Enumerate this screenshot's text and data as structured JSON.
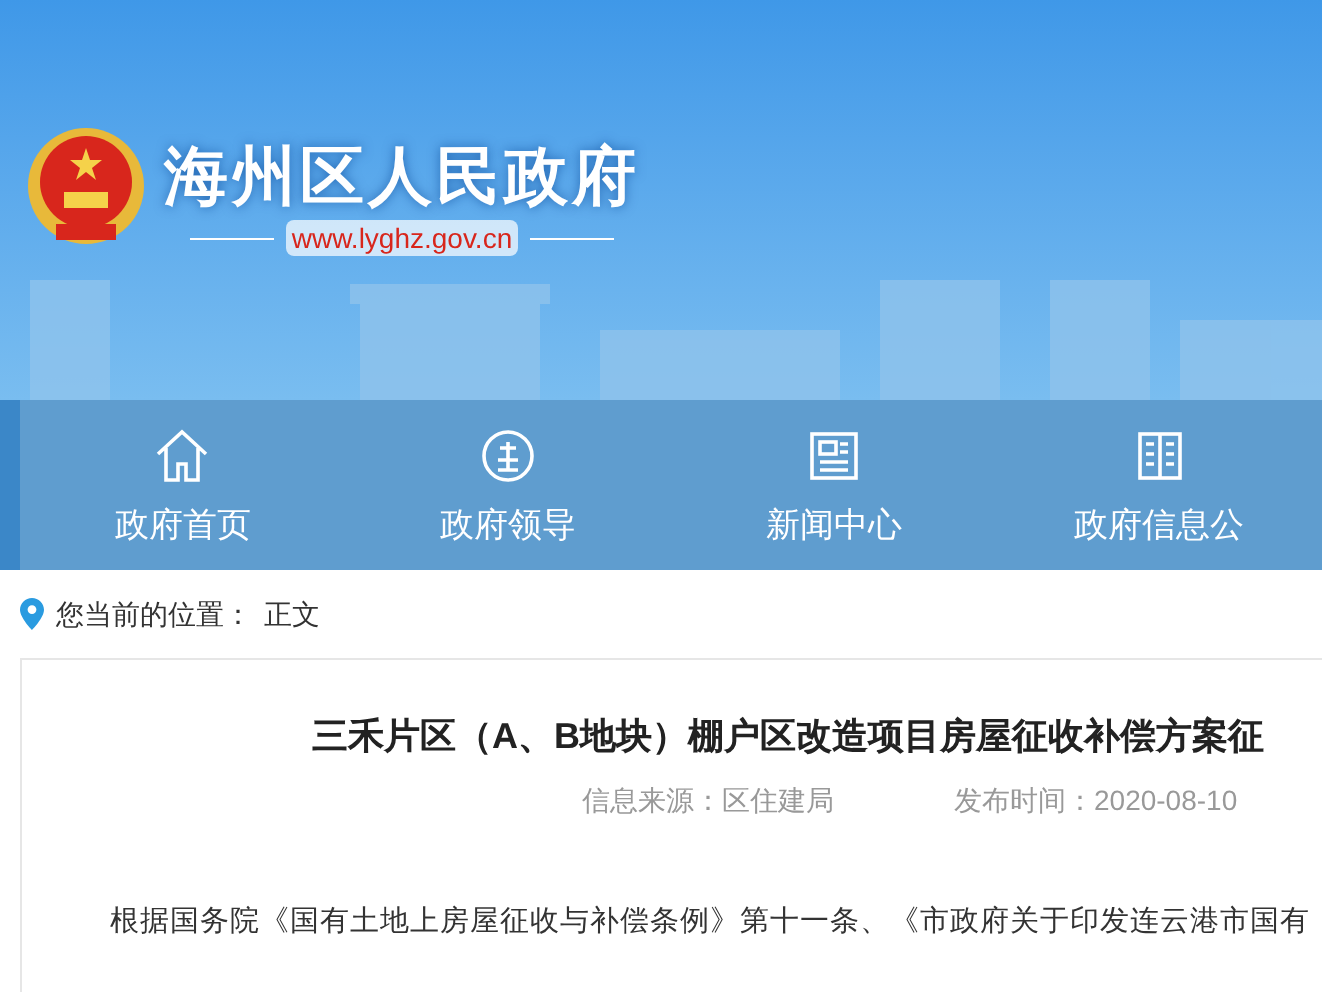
{
  "header": {
    "site_name": "海州区人民政府",
    "url": "www.lyghz.gov.cn"
  },
  "nav": [
    {
      "label": "政府首页",
      "kind": "home"
    },
    {
      "label": "政府领导",
      "kind": "leader"
    },
    {
      "label": "新闻中心",
      "kind": "news"
    },
    {
      "label": "政府信息公",
      "kind": "info"
    }
  ],
  "breadcrumb": {
    "label": "您当前的位置：",
    "current": "正文"
  },
  "article": {
    "title": "三禾片区（A、B地块）棚户区改造项目房屋征收补偿方案征",
    "source": "信息来源：区住建局",
    "date": "发布时间：2020-08-10",
    "body": "根据国务院《国有土地上房屋征收与补偿条例》第十一条、《市政府关于印发连云港市国有"
  }
}
